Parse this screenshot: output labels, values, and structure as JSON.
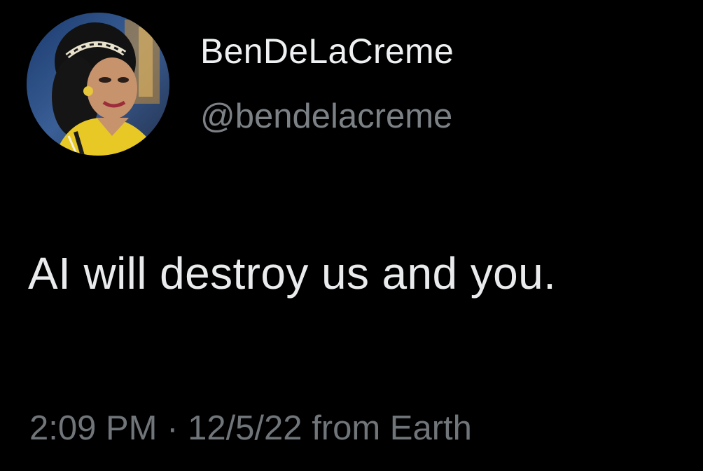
{
  "tweet": {
    "author": {
      "display_name": "BenDeLaCreme",
      "handle": "@bendelacreme",
      "avatar_icon": "profile-photo"
    },
    "text": "AI will destroy us and you.",
    "meta": {
      "time": "2:09 PM",
      "separator": "·",
      "date": "12/5/22",
      "source": "from Earth"
    }
  },
  "colors": {
    "background": "#000000",
    "primary_text": "#e9ebed",
    "secondary_text": "#70757a"
  }
}
